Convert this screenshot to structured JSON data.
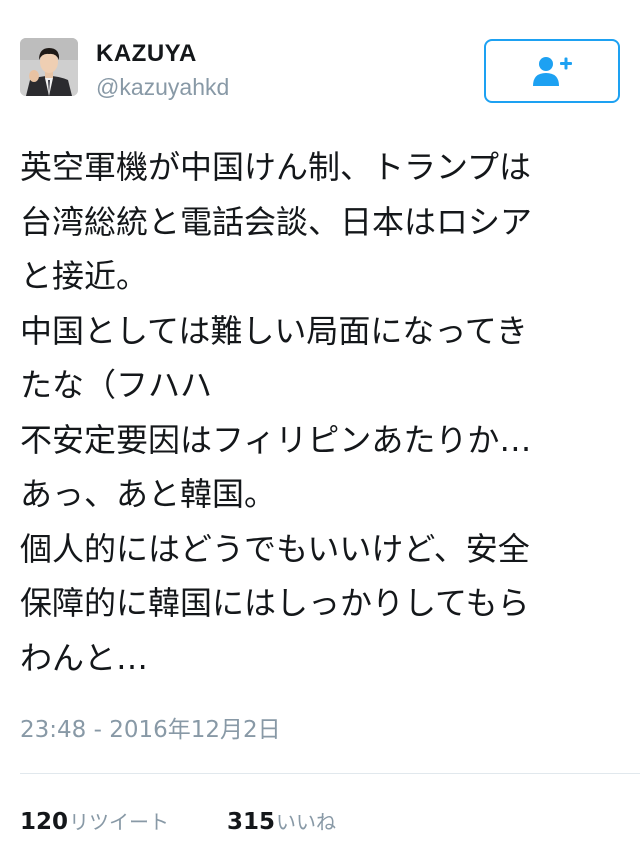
{
  "tweet": {
    "display_name": "KAZUYA",
    "username": "@kazuyahkd",
    "text": "英空軍機が中国けん制、トランプは\n台湾総統と電話会談、日本はロシア\nと接近。\n中国としては難しい局面になってき\nたな（フハハ\n不安定要因はフィリピンあたりか…\nあっ、あと韓国。\n個人的にはどうでもいいけど、安全\n保障的に韓国にはしっかりしてもら\nわんと…",
    "timestamp": "23:48 - 2016年12月2日",
    "retweets": {
      "count": "120",
      "label": "リツイート"
    },
    "likes": {
      "count": "315",
      "label": "いいね"
    }
  },
  "icons": {
    "follow": "add-user-icon",
    "avatar": "profile-photo"
  },
  "colors": {
    "accent": "#1da1f2",
    "secondary_text": "#8899a6",
    "divider": "#e1e8ed",
    "primary_text": "#14171a"
  }
}
